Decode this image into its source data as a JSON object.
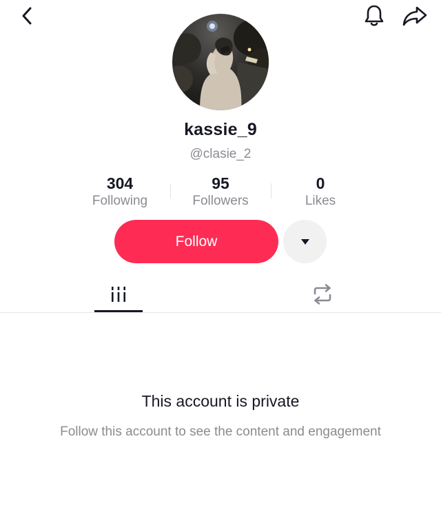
{
  "profile": {
    "username": "kassie_9",
    "handle": "@clasie_2"
  },
  "stats": [
    {
      "value": "304",
      "label": "Following"
    },
    {
      "value": "95",
      "label": "Followers"
    },
    {
      "value": "0",
      "label": "Likes"
    }
  ],
  "actions": {
    "follow_label": "Follow"
  },
  "tabs": [
    {
      "icon": "video-grid-icon",
      "selected": true
    },
    {
      "icon": "repost-icon",
      "selected": false
    }
  ],
  "empty_state": {
    "title": "This account is private",
    "subtitle": "Follow this account to see the content and engagement"
  },
  "colors": {
    "accent": "#fe2c55",
    "text_primary": "#161823",
    "text_secondary": "#8a8b91"
  }
}
